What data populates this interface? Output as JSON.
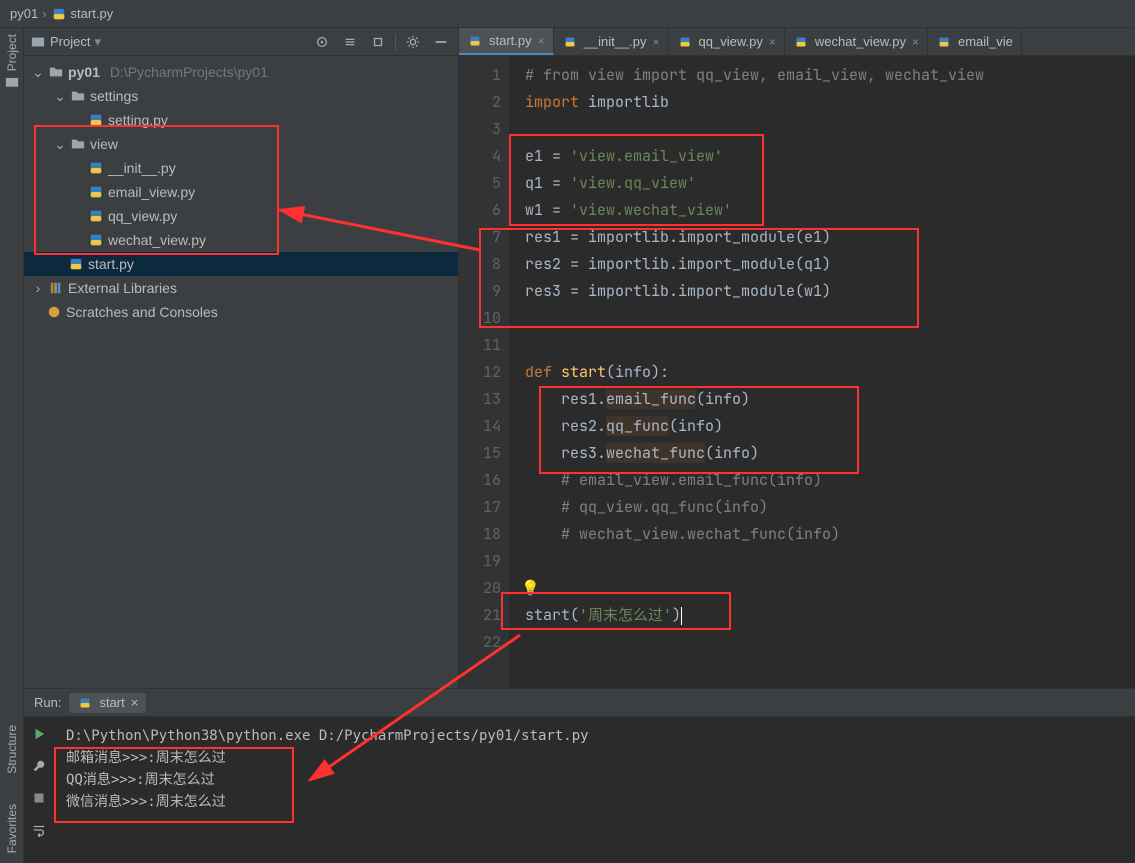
{
  "breadcrumb": {
    "project": "py01",
    "file": "start.py"
  },
  "sidebar": {
    "title": "Project",
    "root": {
      "name": "py01",
      "path": "D:\\PycharmProjects\\py01"
    },
    "settings_folder": "settings",
    "setting_py": "setting.py",
    "view_folder": "view",
    "view_files": {
      "init": "__init__.py",
      "email": "email_view.py",
      "qq": "qq_view.py",
      "wechat": "wechat_view.py"
    },
    "start_py": "start.py",
    "external": "External Libraries",
    "scratches": "Scratches and Consoles"
  },
  "tabs": [
    {
      "label": "start.py",
      "active": true
    },
    {
      "label": "__init__.py",
      "active": false
    },
    {
      "label": "qq_view.py",
      "active": false
    },
    {
      "label": "wechat_view.py",
      "active": false
    },
    {
      "label": "email_vie",
      "active": false
    }
  ],
  "gutter_lines": [
    "1",
    "2",
    "3",
    "4",
    "5",
    "6",
    "7",
    "8",
    "9",
    "10",
    "11",
    "12",
    "13",
    "14",
    "15",
    "16",
    "17",
    "18",
    "19",
    "20",
    "21",
    "22"
  ],
  "code": {
    "l1": "# from view import qq_view, email_view, wechat_view",
    "l2a": "import",
    "l2b": " importlib",
    "l4a": "e1 = ",
    "l4b": "'view.email_view'",
    "l5a": "q1 = ",
    "l5b": "'view.qq_view'",
    "l6a": "w1 = ",
    "l6b": "'view.wechat_view'",
    "l7": "res1 = importlib.import_module(e1)",
    "l8": "res2 = importlib.import_module(q1)",
    "l9": "res3 = importlib.import_module(w1)",
    "l12a": "def ",
    "l12b": "start",
    "l12c": "(info):",
    "l13a": "    res1.",
    "l13b": "email_func",
    "l13c": "(info)",
    "l14a": "    res2.",
    "l14b": "qq_func",
    "l14c": "(info)",
    "l15a": "    res3.",
    "l15b": "wechat_func",
    "l15c": "(info)",
    "l16": "    # email_view.email_func(info)",
    "l17": "    # qq_view.qq_func(info)",
    "l18": "    # wechat_view.wechat_func(info)",
    "l21a": "start(",
    "l21b": "'周末怎么过'",
    "l21c": ")"
  },
  "run": {
    "label": "Run:",
    "tab": "start",
    "cmd": "D:\\Python\\Python38\\python.exe D:/PycharmProjects/py01/start.py",
    "out1": "邮箱消息>>>:周末怎么过",
    "out2": "QQ消息>>>:周末怎么过",
    "out3": "微信消息>>>:周末怎么过"
  },
  "leftrail": {
    "project": "Project",
    "structure": "Structure",
    "favorites": "Favorites"
  }
}
